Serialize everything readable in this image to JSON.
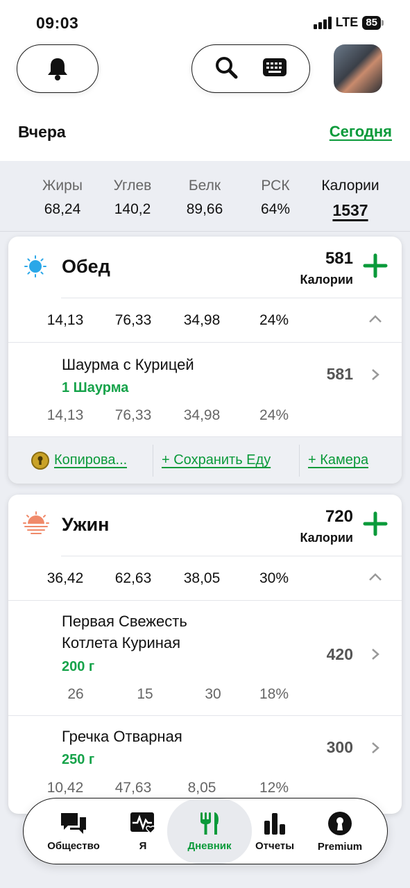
{
  "status_bar": {
    "time": "09:03",
    "network": "LTE",
    "battery": "85"
  },
  "header": {
    "icons": {
      "bell": "bell-icon",
      "search": "search-icon",
      "keyboard": "keyboard-icon"
    },
    "date_prev": "Вчера",
    "date_today": "Сегодня"
  },
  "summary": {
    "fat_label": "Жиры",
    "fat_value": "68,24",
    "carbs_label": "Углев",
    "carbs_value": "140,2",
    "protein_label": "Белк",
    "protein_value": "89,66",
    "rdi_label": "РСК",
    "rdi_value": "64%",
    "cal_label": "Калории",
    "cal_value": "1537"
  },
  "meals": [
    {
      "title": "Обед",
      "calories": "581",
      "calories_label": "Калории",
      "macros": [
        "14,13",
        "76,33",
        "34,98",
        "24%"
      ],
      "items": [
        {
          "name": "Шаурма с Курицей",
          "portion": "1 Шаурма",
          "calories": "581",
          "macros": [
            "14,13",
            "76,33",
            "34,98",
            "24%"
          ]
        }
      ],
      "actions": {
        "copy": "Копирова...",
        "save": "+ Сохранить Еду",
        "camera": "+ Камера"
      }
    },
    {
      "title": "Ужин",
      "calories": "720",
      "calories_label": "Калории",
      "macros": [
        "36,42",
        "62,63",
        "38,05",
        "30%"
      ],
      "items": [
        {
          "name_line1": "Первая Свежесть",
          "name_line2": "Котлета Куриная",
          "portion": "200 г",
          "calories": "420",
          "macros": [
            "26",
            "15",
            "30",
            "18%"
          ]
        },
        {
          "name": "Гречка Отварная",
          "portion": "250 г",
          "calories": "300",
          "macros": [
            "10,42",
            "47,63",
            "8,05",
            "12%"
          ]
        }
      ]
    }
  ],
  "tabs": [
    {
      "label": "Общество",
      "icon": "chat-bubbles-icon"
    },
    {
      "label": "Я",
      "icon": "heart-pulse-icon"
    },
    {
      "label": "Дневник",
      "icon": "fork-knife-icon",
      "active": true
    },
    {
      "label": "Отчеты",
      "icon": "bar-chart-icon"
    },
    {
      "label": "Premium",
      "icon": "keyhole-icon"
    }
  ],
  "colors": {
    "accent_green": "#0a9a3a",
    "lunch_icon": "#2aa7e8",
    "dinner_icon": "#f08a6a"
  }
}
